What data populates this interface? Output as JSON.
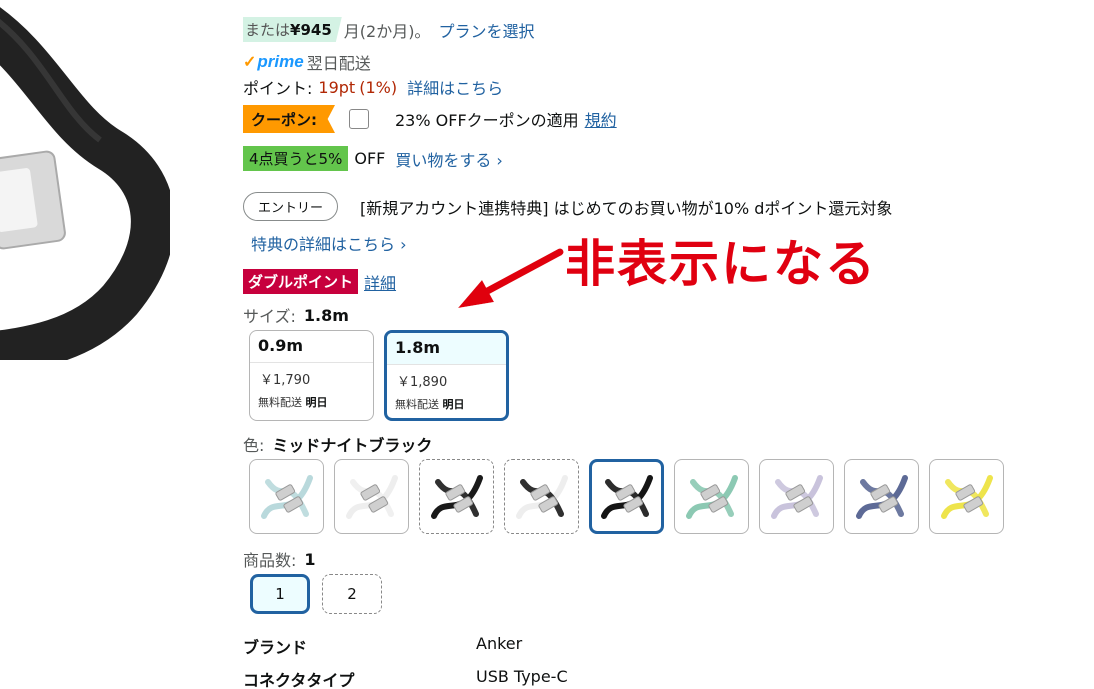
{
  "installment": {
    "prefix": "または",
    "amount": "¥945",
    "suffix": "月(2か月)。",
    "plan_link": "プランを選択"
  },
  "prime": {
    "logo": "prime",
    "delivery": "翌日配送"
  },
  "points": {
    "label": "ポイント:",
    "value": "19pt",
    "percent": "(1%)",
    "details_link": "詳細はこちら"
  },
  "coupon": {
    "badge": "クーポン:",
    "text": "23% OFFクーポンの適用",
    "terms_link": "規約"
  },
  "bulk": {
    "badge": "4点買うと5%",
    "off": "OFF",
    "link": "買い物をする ›"
  },
  "entry": {
    "button": "エントリー",
    "text": "[新規アカウント連携特典] はじめてのお買い物が10% dポイント還元対象",
    "details_link": "特典の詳細はこちら ›"
  },
  "double_point": {
    "badge": "ダブルポイント",
    "details_link": "詳細"
  },
  "annotation": {
    "text": "非表示になる",
    "color": "#e00010"
  },
  "size": {
    "label": "サイズ:",
    "selected": "1.8m",
    "options": [
      {
        "name": "0.9m",
        "price": "￥1,790",
        "ship_prefix": "無料配送",
        "ship_day": "明日"
      },
      {
        "name": "1.8m",
        "price": "￥1,890",
        "ship_prefix": "無料配送",
        "ship_day": "明日"
      }
    ]
  },
  "color": {
    "label": "色:",
    "selected": "ミッドナイトブラック",
    "swatches": [
      {
        "name": "light-blue",
        "hex": "#b9d9dc"
      },
      {
        "name": "white",
        "hex": "#eeeeee"
      },
      {
        "name": "black-pair",
        "hex": "#1a1a1a"
      },
      {
        "name": "white-black-pair",
        "hex": "#dddddd"
      },
      {
        "name": "midnight-black",
        "hex": "#151515"
      },
      {
        "name": "mint-green",
        "hex": "#8cc9b3"
      },
      {
        "name": "lavender",
        "hex": "#c9c3dc"
      },
      {
        "name": "slate-blue",
        "hex": "#5d6a96"
      },
      {
        "name": "yellow",
        "hex": "#eee44c"
      }
    ]
  },
  "quantity": {
    "label": "商品数:",
    "selected": "1",
    "options": [
      "1",
      "2"
    ]
  },
  "specs": [
    {
      "label": "ブランド",
      "value": "Anker"
    },
    {
      "label": "コネクタタイプ",
      "value": "USB Type-C"
    }
  ],
  "colors": {
    "link": "#2162a1",
    "selected_border": "#2162a1",
    "prime": "#1a98ff",
    "coupon": "#ff9900",
    "price_red": "#b12704"
  }
}
